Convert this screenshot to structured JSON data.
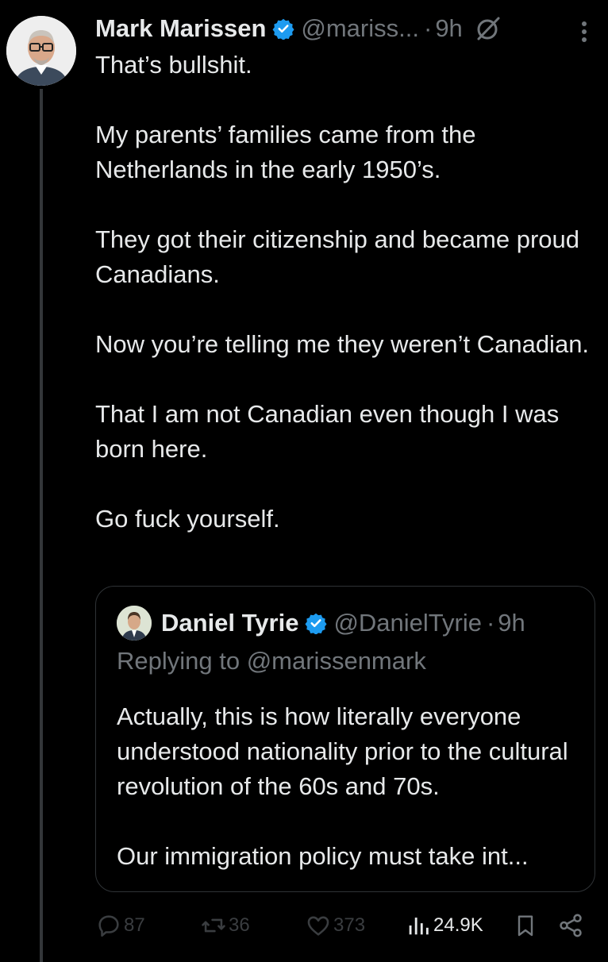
{
  "tweet": {
    "author_name": "Mark Marissen",
    "author_handle": "@mariss...",
    "separator": "·",
    "time": "9h",
    "paragraphs": [
      "That’s bullshit.",
      "My parents’ families came from the Netherlands in the early 1950’s.",
      "They got their citizenship and became proud Canadians.",
      "Now you’re telling me they weren’t Canadian.",
      "That I am not Canadian even though I was born here.",
      "Go fuck yourself."
    ]
  },
  "quote": {
    "author_name": "Daniel Tyrie",
    "author_handle": "@DanielTyrie",
    "separator": "·",
    "time": "9h",
    "replying_to": "Replying to @marissenmark",
    "paragraphs": [
      "Actually, this is how literally everyone understood nationality prior to the cultural revolution of the 60s and 70s.",
      "Our immigration policy must take int..."
    ]
  },
  "actions": {
    "replies": "87",
    "reposts": "36",
    "likes": "373",
    "views": "24.9K"
  },
  "colors": {
    "background": "#000000",
    "text": "#e7e9ea",
    "secondary": "#71767b",
    "verified": "#1d9bf0",
    "border": "#2f3336"
  },
  "icons": [
    "verified-badge-icon",
    "grok-icon",
    "more-icon",
    "reply-icon",
    "repost-icon",
    "like-icon",
    "views-icon",
    "bookmark-icon",
    "share-icon"
  ]
}
